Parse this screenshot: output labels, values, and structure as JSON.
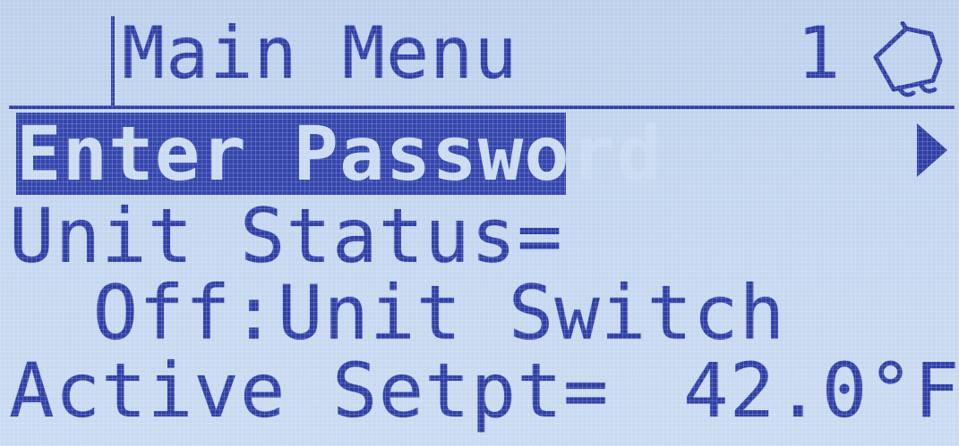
{
  "header": {
    "title": "Main Menu",
    "page_number": "1",
    "alarm_icon": "bell-icon"
  },
  "menu": {
    "selected": "Enter Password",
    "items": [
      {
        "label": "Enter Password",
        "submenu_icon": "arrow-right-icon"
      },
      {
        "label": "Unit Status=",
        "value": " Off:Unit Switch"
      },
      {
        "label": "Active Setpt=",
        "value": "42.0°F"
      }
    ]
  },
  "colors": {
    "lcd_background": "#c4d6ef",
    "lcd_foreground": "#2f3fa6"
  }
}
